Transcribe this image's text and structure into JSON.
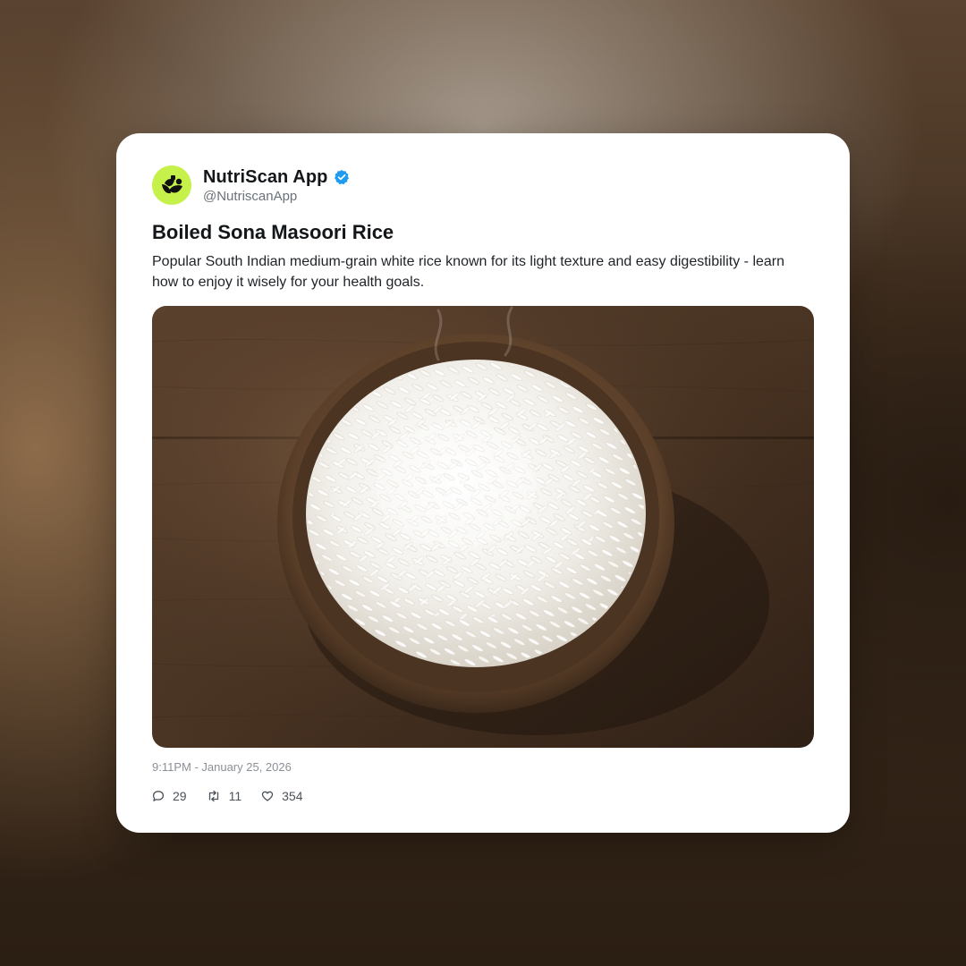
{
  "post": {
    "author_name": "NutriScan App",
    "author_handle": "@NutriscanApp",
    "verified": true,
    "title": "Boiled Sona Masoori Rice",
    "description": "Popular South Indian medium-grain white rice known for its light texture and easy digestibility - learn how to enjoy it wisely for your health goals.",
    "timestamp": "9:11PM - January 25, 2026",
    "replies": "29",
    "reposts": "11",
    "likes": "354"
  },
  "icons": {
    "avatar": "nutriscan-logo-icon",
    "verified": "verified-badge-icon",
    "reply": "reply-icon",
    "repost": "repost-icon",
    "like": "heart-icon"
  },
  "colors": {
    "avatar_bg": "#c6f04a",
    "verified_blue": "#1d9bf0",
    "card_bg": "#ffffff"
  }
}
